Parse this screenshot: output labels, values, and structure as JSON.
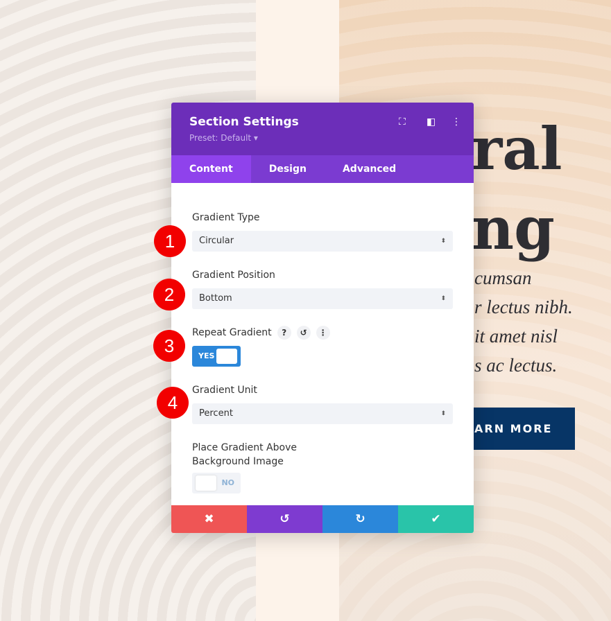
{
  "background": {
    "heading_line1": "ral",
    "heading_line2": "ng",
    "body_lines": [
      "cumsan",
      "r lectus nibh.",
      "it amet nisl",
      "s ac lectus."
    ],
    "button": "ARN MORE"
  },
  "modal": {
    "title": "Section Settings",
    "preset": "Preset: Default ▾",
    "header_icons": [
      "fullscreen-icon",
      "sidebar-layout-icon",
      "more-vertical-icon"
    ],
    "tabs": [
      {
        "label": "Content",
        "active": true
      },
      {
        "label": "Design"
      },
      {
        "label": "Advanced"
      }
    ],
    "fields": {
      "gradient_type": {
        "label": "Gradient Type",
        "value": "Circular"
      },
      "gradient_position": {
        "label": "Gradient Position",
        "value": "Bottom"
      },
      "repeat_gradient": {
        "label": "Repeat Gradient",
        "value": "YES",
        "help": "?",
        "reset": "↺",
        "more": "⋮"
      },
      "gradient_unit": {
        "label": "Gradient Unit",
        "value": "Percent"
      },
      "place_above": {
        "label_line1": "Place Gradient Above",
        "label_line2": "Background Image",
        "value": "NO"
      }
    },
    "footer": {
      "cancel": "✖",
      "undo": "↺",
      "redo": "↻",
      "save": "✔"
    },
    "colors": {
      "header": "#6c2eb9",
      "tabs": "#7b3bd1",
      "cancel": "#ef5555",
      "undo": "#7e3bd0",
      "redo": "#2b87da",
      "save": "#29c4a9"
    }
  },
  "badges": [
    "1",
    "2",
    "3",
    "4"
  ]
}
